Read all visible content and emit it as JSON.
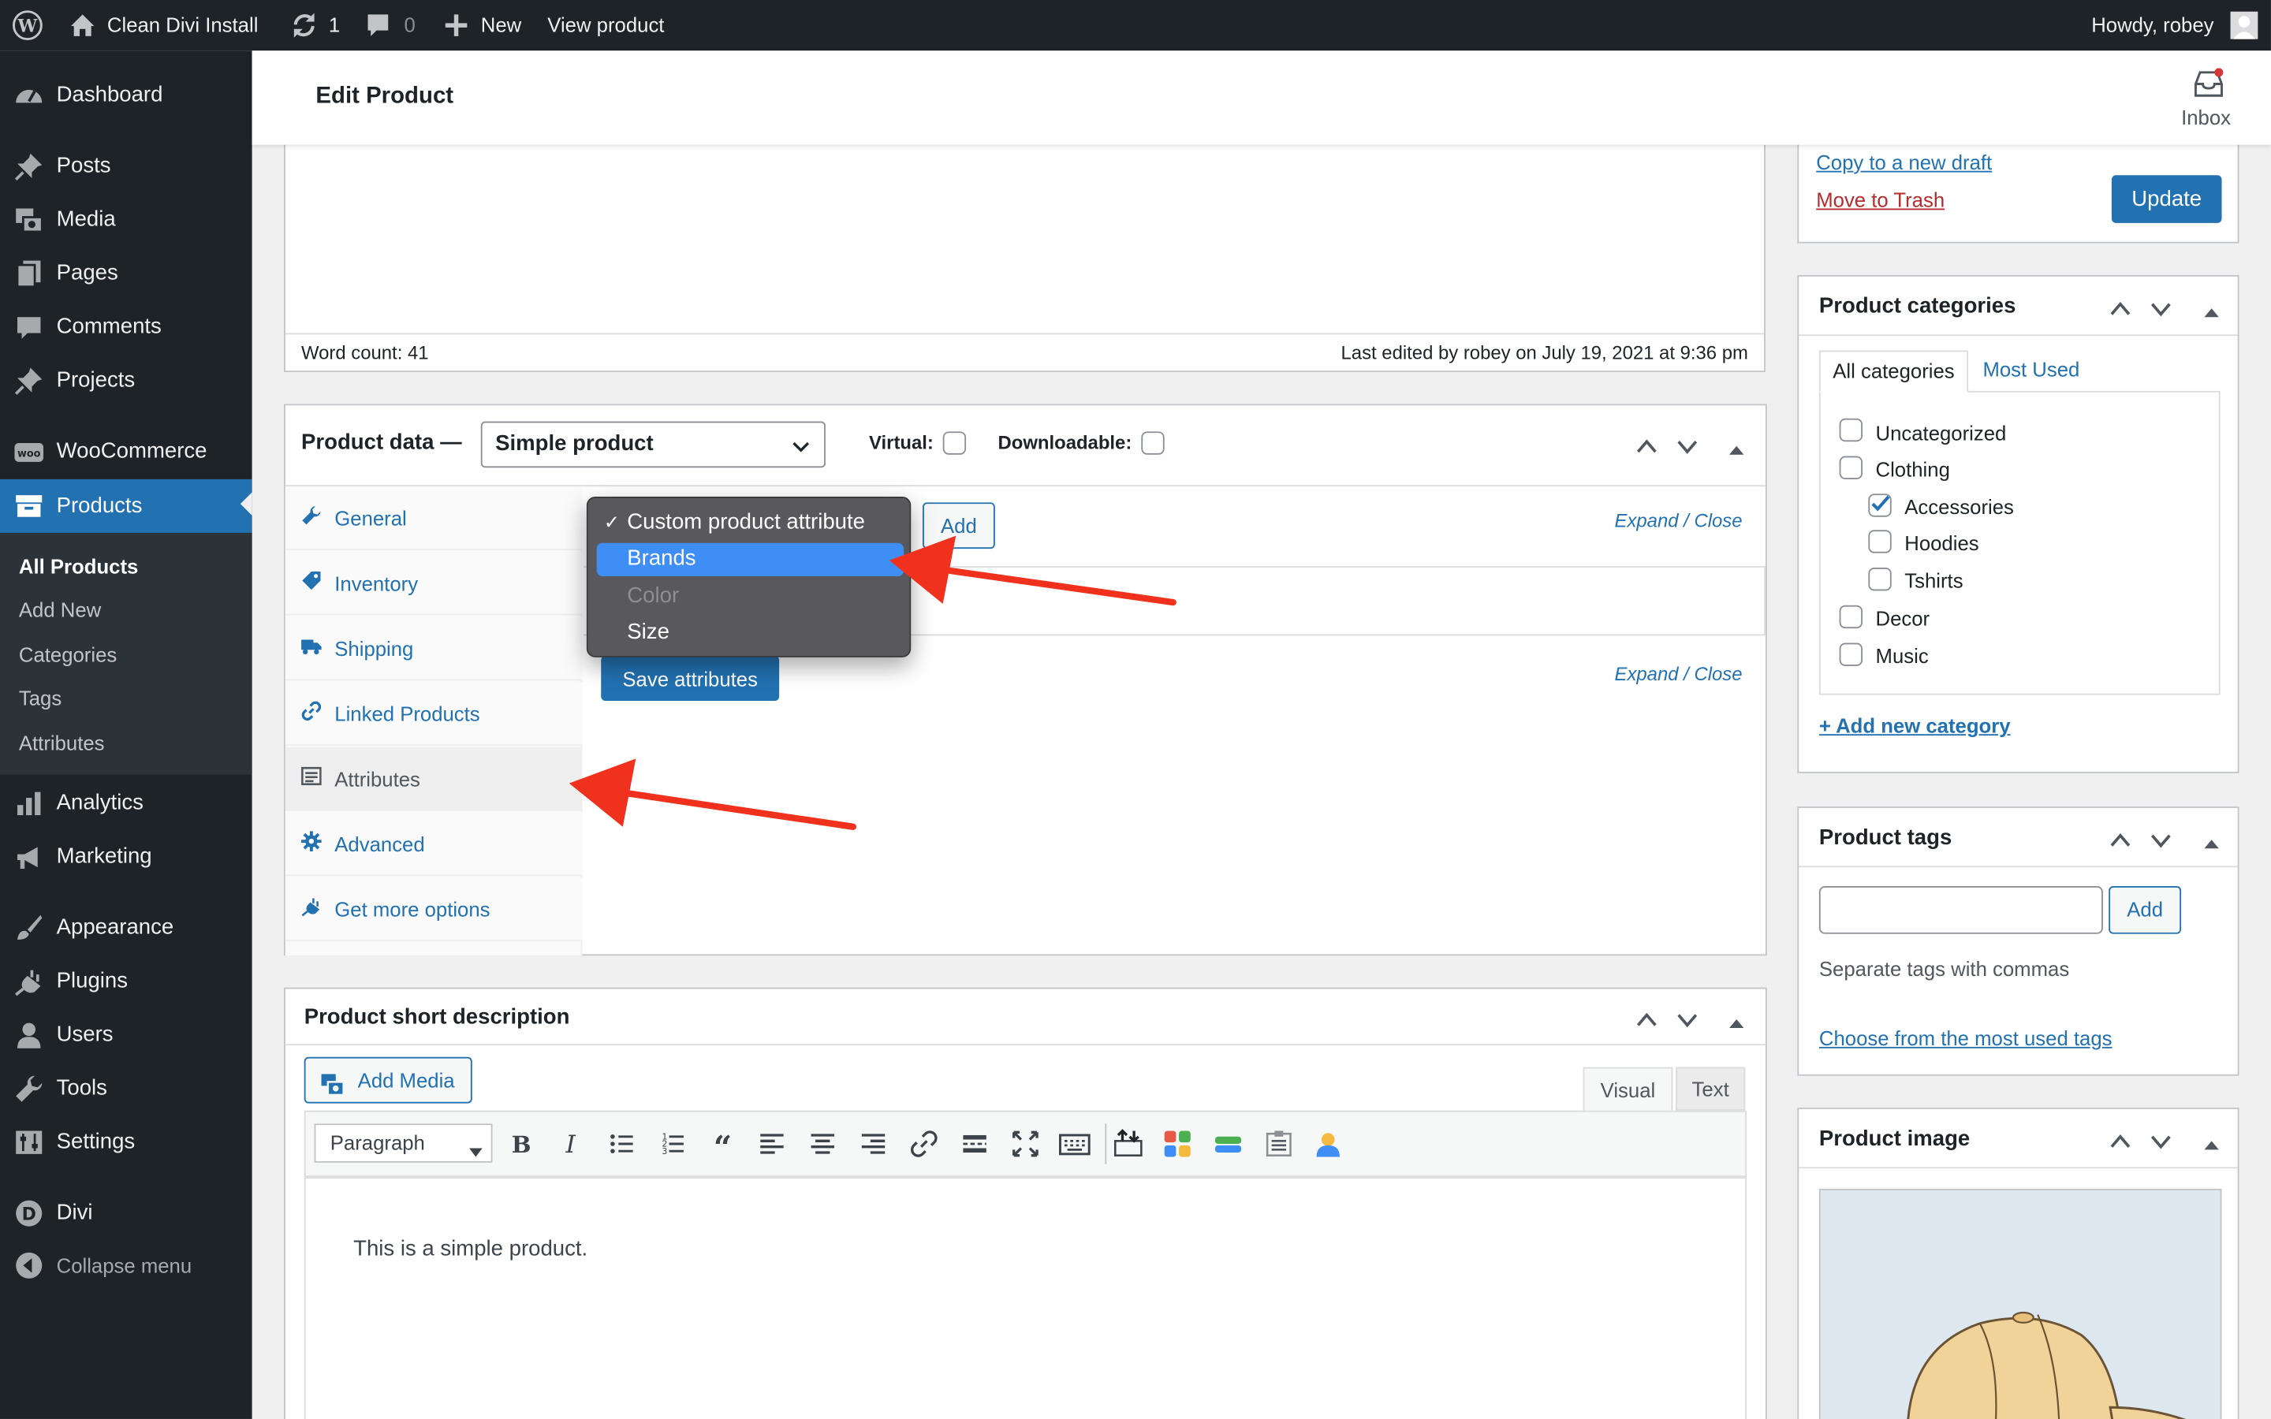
{
  "admin_bar": {
    "site_name": "Clean Divi Install",
    "updates_count": "1",
    "comments_count": "0",
    "new_label": "New",
    "view_product_label": "View product",
    "howdy": "Howdy, robey"
  },
  "sidebar": {
    "items": [
      {
        "label": "Dashboard",
        "icon": "dashboard-icon"
      },
      {
        "label": "Posts",
        "icon": "pin-icon"
      },
      {
        "label": "Media",
        "icon": "media-icon"
      },
      {
        "label": "Pages",
        "icon": "pages-icon"
      },
      {
        "label": "Comments",
        "icon": "comment-icon"
      },
      {
        "label": "Projects",
        "icon": "pin-icon"
      },
      {
        "label": "WooCommerce",
        "icon": "woo-icon"
      },
      {
        "label": "Products",
        "icon": "archive-icon"
      },
      {
        "label": "Analytics",
        "icon": "chart-icon"
      },
      {
        "label": "Marketing",
        "icon": "megaphone-icon"
      },
      {
        "label": "Appearance",
        "icon": "brush-icon"
      },
      {
        "label": "Plugins",
        "icon": "plug-icon"
      },
      {
        "label": "Users",
        "icon": "user-icon"
      },
      {
        "label": "Tools",
        "icon": "wrench-icon"
      },
      {
        "label": "Settings",
        "icon": "settings-icon"
      },
      {
        "label": "Divi",
        "icon": "divi-icon"
      }
    ],
    "submenu": [
      "All Products",
      "Add New",
      "Categories",
      "Tags",
      "Attributes"
    ],
    "collapse_label": "Collapse menu"
  },
  "header": {
    "title": "Edit Product",
    "inbox_label": "Inbox"
  },
  "editor": {
    "word_count": "Word count: 41",
    "last_edited": "Last edited by robey on July 19, 2021 at 9:36 pm"
  },
  "product_data": {
    "title": "Product data —",
    "type_value": "Simple product",
    "virtual_label": "Virtual:",
    "downloadable_label": "Downloadable:",
    "tabs": [
      {
        "label": "General",
        "icon": "wrench-icon"
      },
      {
        "label": "Inventory",
        "icon": "tag-icon"
      },
      {
        "label": "Shipping",
        "icon": "truck-icon"
      },
      {
        "label": "Linked Products",
        "icon": "link-icon"
      },
      {
        "label": "Attributes",
        "icon": "list-icon"
      },
      {
        "label": "Advanced",
        "icon": "gear-icon"
      },
      {
        "label": "Get more options",
        "icon": "plug-icon"
      }
    ],
    "dropdown_options": [
      "Custom product attribute",
      "Brands",
      "Color",
      "Size"
    ],
    "add_label": "Add",
    "expand_label": "Expand",
    "slash": "/",
    "close_label": "Close",
    "save_attributes_label": "Save attributes"
  },
  "short_description": {
    "title": "Product short description",
    "add_media_label": "Add Media",
    "tab_visual": "Visual",
    "tab_text": "Text",
    "format_value": "Paragraph",
    "content": "This is a simple product."
  },
  "publish": {
    "copy_draft": "Copy to a new draft",
    "move_trash": "Move to Trash",
    "update_label": "Update"
  },
  "categories": {
    "title": "Product categories",
    "tab_all": "All categories",
    "tab_most_used": "Most Used",
    "items": [
      {
        "label": "Uncategorized",
        "checked": false,
        "child": false
      },
      {
        "label": "Clothing",
        "checked": false,
        "child": false
      },
      {
        "label": "Accessories",
        "checked": true,
        "child": true
      },
      {
        "label": "Hoodies",
        "checked": false,
        "child": true
      },
      {
        "label": "Tshirts",
        "checked": false,
        "child": true
      },
      {
        "label": "Decor",
        "checked": false,
        "child": false
      },
      {
        "label": "Music",
        "checked": false,
        "child": false
      }
    ],
    "add_new": "+ Add new category"
  },
  "tags": {
    "title": "Product tags",
    "add_label": "Add",
    "hint": "Separate tags with commas",
    "choose_link": "Choose from the most used tags"
  },
  "product_image": {
    "title": "Product image"
  },
  "colors": {
    "admin_dark": "#1d2327",
    "accent": "#2271b1",
    "trash": "#b32d2e",
    "arrow": "#f0311e"
  }
}
